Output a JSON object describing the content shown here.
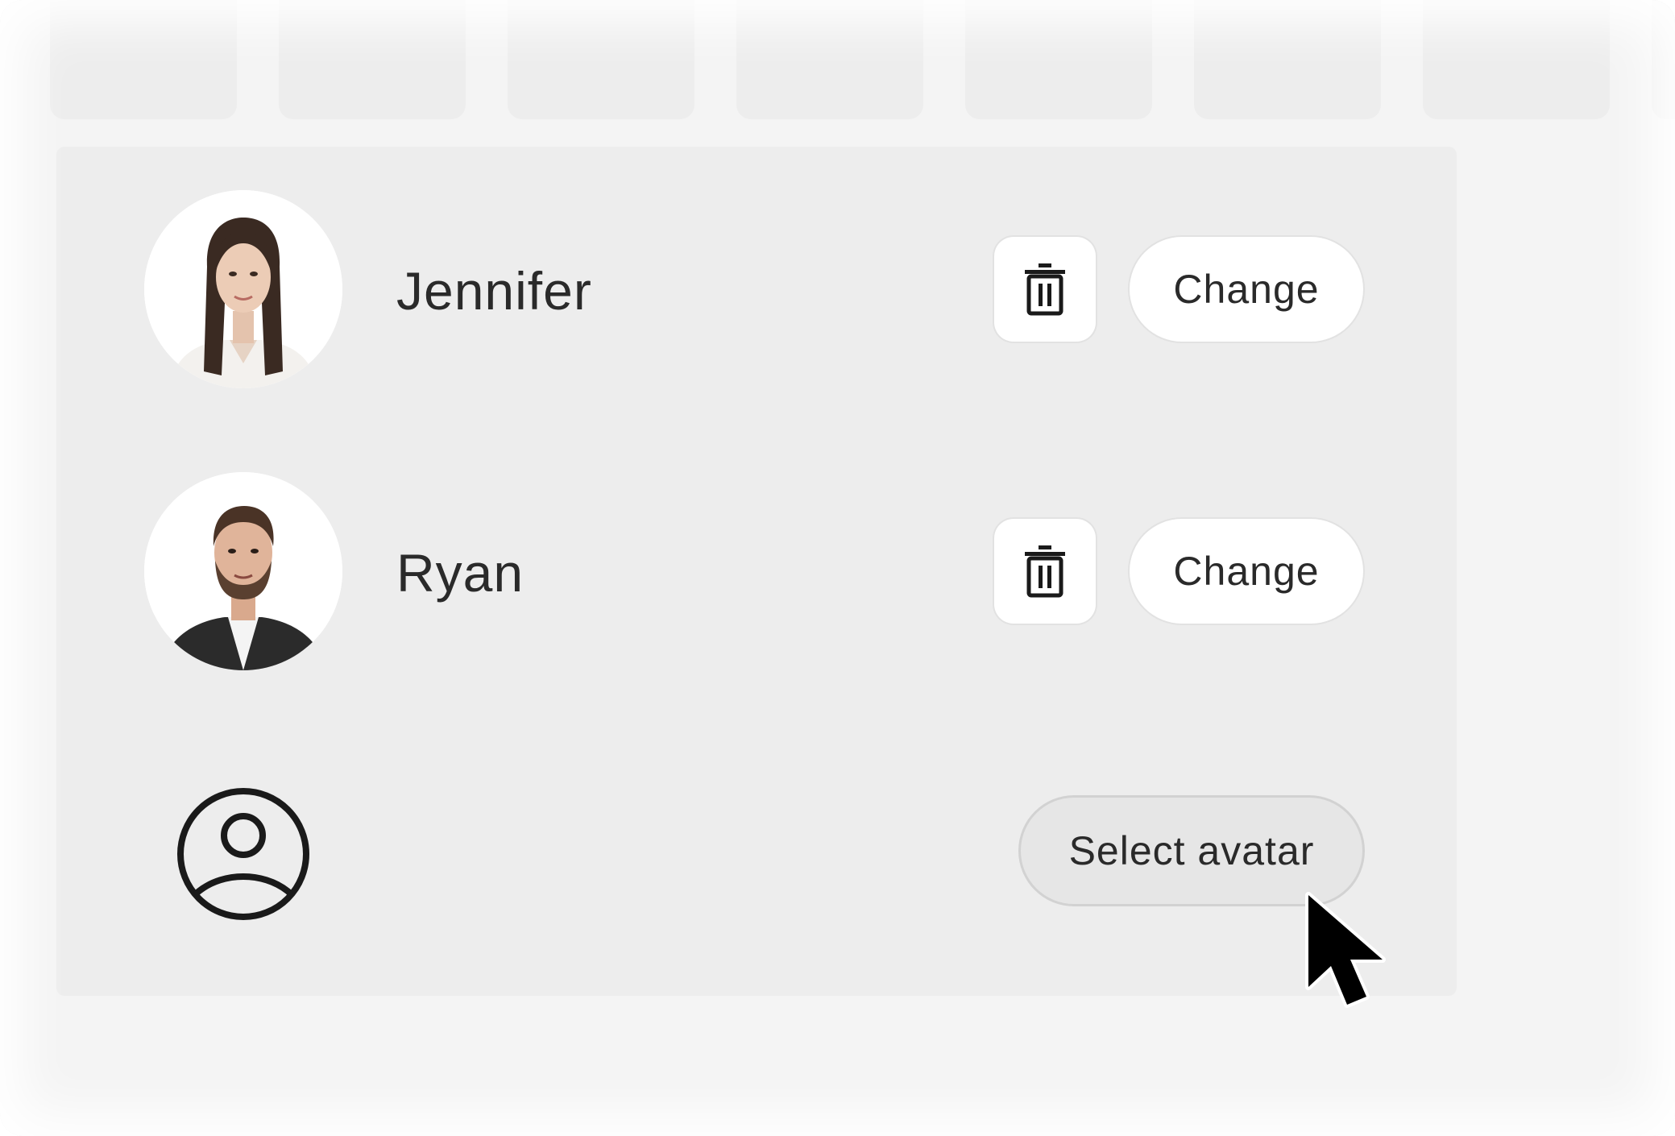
{
  "avatars": [
    {
      "name": "Jennifer",
      "delete_icon": "trash-icon",
      "change_label": "Change"
    },
    {
      "name": "Ryan",
      "delete_icon": "trash-icon",
      "change_label": "Change"
    }
  ],
  "empty_slot": {
    "icon": "user-circle-icon",
    "select_label": "Select avatar"
  },
  "cursor_icon": "mouse-pointer-icon",
  "colors": {
    "background": "#f4f4f4",
    "panel": "#ededed",
    "button": "#ffffff",
    "select_button": "#e6e6e6",
    "text": "#2a2a2a"
  }
}
